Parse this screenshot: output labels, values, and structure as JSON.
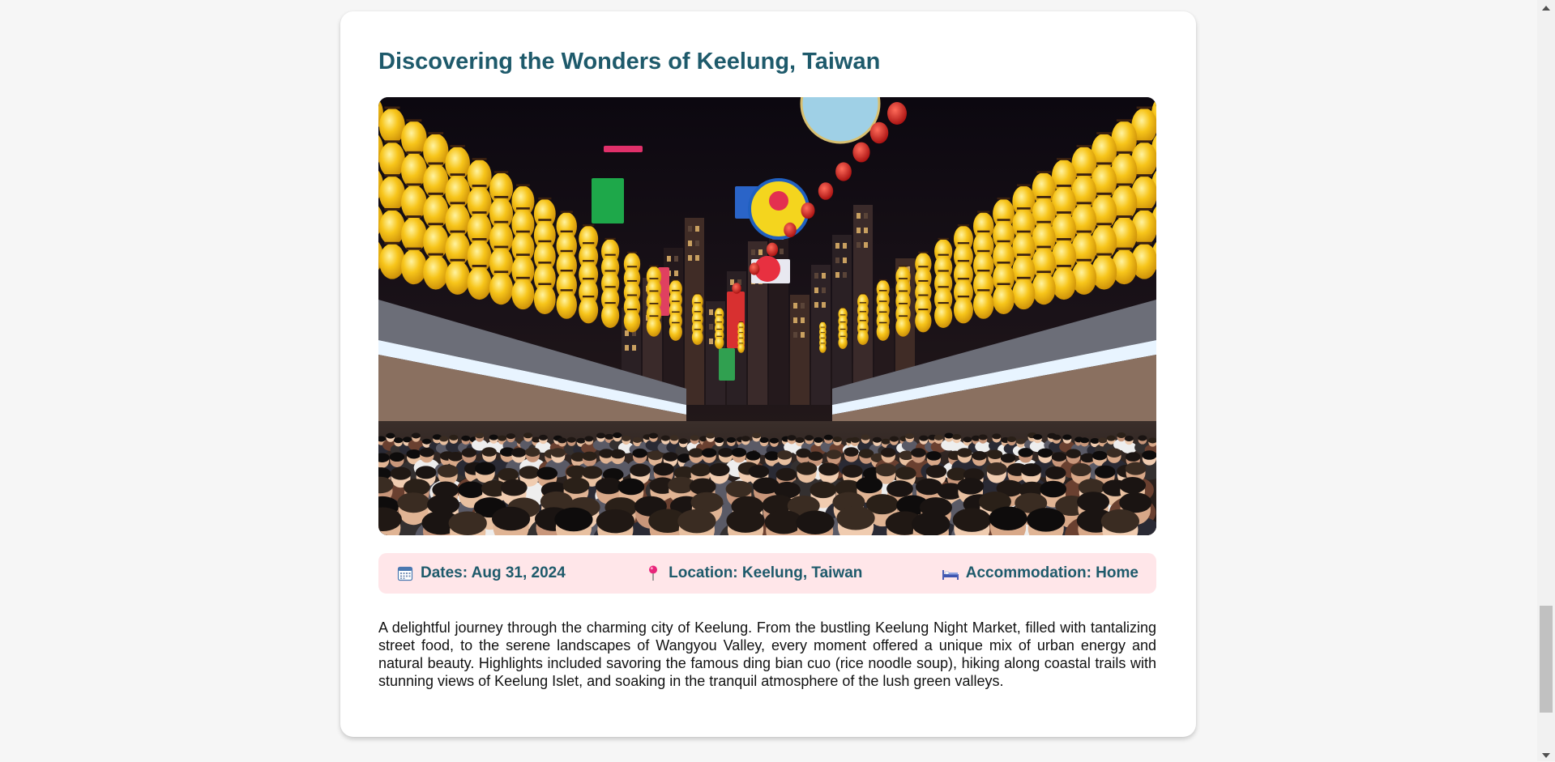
{
  "article": {
    "title": "Discovering the Wonders of Keelung, Taiwan",
    "image_alt": "Keelung Night Market with rows of yellow lanterns and crowds",
    "info": {
      "dates_label": "Dates: Aug 31, 2024",
      "location_label": "Location: Keelung, Taiwan",
      "accommodation_label": "Accommodation: Home",
      "dates_icon": "calendar-icon",
      "location_icon": "pin-icon",
      "accommodation_icon": "bed-icon"
    },
    "description": "A delightful journey through the charming city of Keelung. From the bustling Keelung Night Market, filled with tantalizing street food, to the serene landscapes of Wangyou Valley, every moment offered a unique mix of urban energy and natural beauty. Highlights included savoring the famous ding bian cuo (rice noodle soup), hiking along coastal trails with stunning views of Keelung Islet, and soaking in the tranquil atmosphere of the lush green valleys."
  },
  "colors": {
    "title": "#1e5a6b",
    "info_bar_bg": "#ffe6e9",
    "lantern": "#f5c518",
    "page_bg": "#f6f6f6"
  },
  "scrollbar": {
    "up_icon": "triangle-up-icon",
    "down_icon": "triangle-down-icon"
  }
}
